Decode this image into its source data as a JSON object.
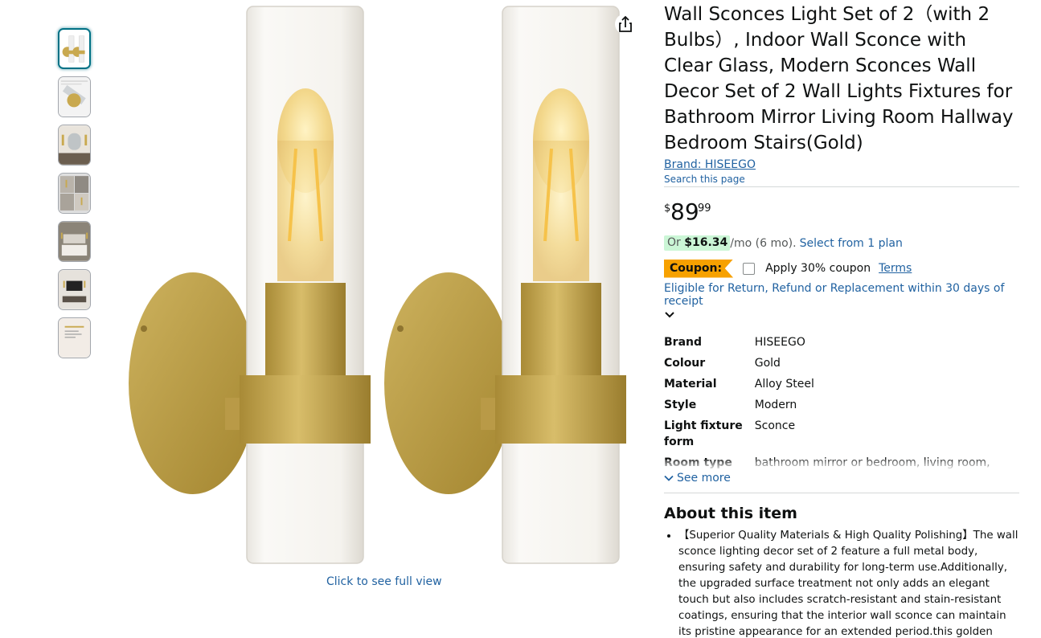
{
  "thumbnails": [
    {
      "name": "thumb-1",
      "selected": true
    },
    {
      "name": "thumb-2",
      "selected": false
    },
    {
      "name": "thumb-3",
      "selected": false
    },
    {
      "name": "thumb-4",
      "selected": false
    },
    {
      "name": "thumb-5",
      "selected": false
    },
    {
      "name": "thumb-6",
      "selected": false
    },
    {
      "name": "thumb-7",
      "selected": false
    }
  ],
  "gallery": {
    "full_view_label": "Click to see full view",
    "share_icon": "share-icon"
  },
  "product": {
    "title": "Wall Sconces Light Set of 2（with 2 Bulbs）, Indoor Wall Sconce with Clear Glass, Modern Sconces Wall Decor Set of 2 Wall Lights Fixtures for Bathroom Mirror Living Room Hallway Bedroom Stairs(Gold)",
    "brand_link": "Brand: HISEEGO",
    "search_page": "Search this page"
  },
  "price": {
    "symbol": "$",
    "whole": "89",
    "fraction": "99"
  },
  "installment": {
    "prefix": "Or ",
    "amount": "$16.34",
    "suffix": "/mo (6 mo).",
    "plan_link": "Select from 1 plan"
  },
  "coupon": {
    "badge": "Coupon:",
    "label": "Apply 30% coupon",
    "terms": "Terms"
  },
  "return_policy": "Eligible for Return, Refund or Replacement within 30 days of receipt",
  "specs": [
    {
      "key": "Brand",
      "value": "HISEEGO"
    },
    {
      "key": "Colour",
      "value": "Gold"
    },
    {
      "key": "Material",
      "value": "Alloy Steel"
    },
    {
      "key": "Style",
      "value": "Modern"
    },
    {
      "key": "Light fixture form",
      "value": "Sconce"
    },
    {
      "key": "Room type",
      "value": "bathroom mirror or bedroom, living room, dressing table, stairs, hallway, kitchen"
    }
  ],
  "see_more": "See more",
  "about": {
    "heading": "About this item",
    "bullets": [
      "【Superior Quality Materials & High Quality Polishing】The wall sconce lighting decor set of 2 feature a full metal body, ensuring safety and durability for long-term use.Additionally, the upgraded surface treatment not only adds an elegant touch but also includes scratch-resistant and stain-resistant coatings, ensuring that the interior wall sconce can maintain its pristine appearance for an extended period.this golden brass --has been treated to"
    ]
  },
  "colors": {
    "link": "#2162a1",
    "coupon_badge": "#f7a100",
    "installment_highlight": "#cbf6d6",
    "gold": "#c8a84b"
  }
}
